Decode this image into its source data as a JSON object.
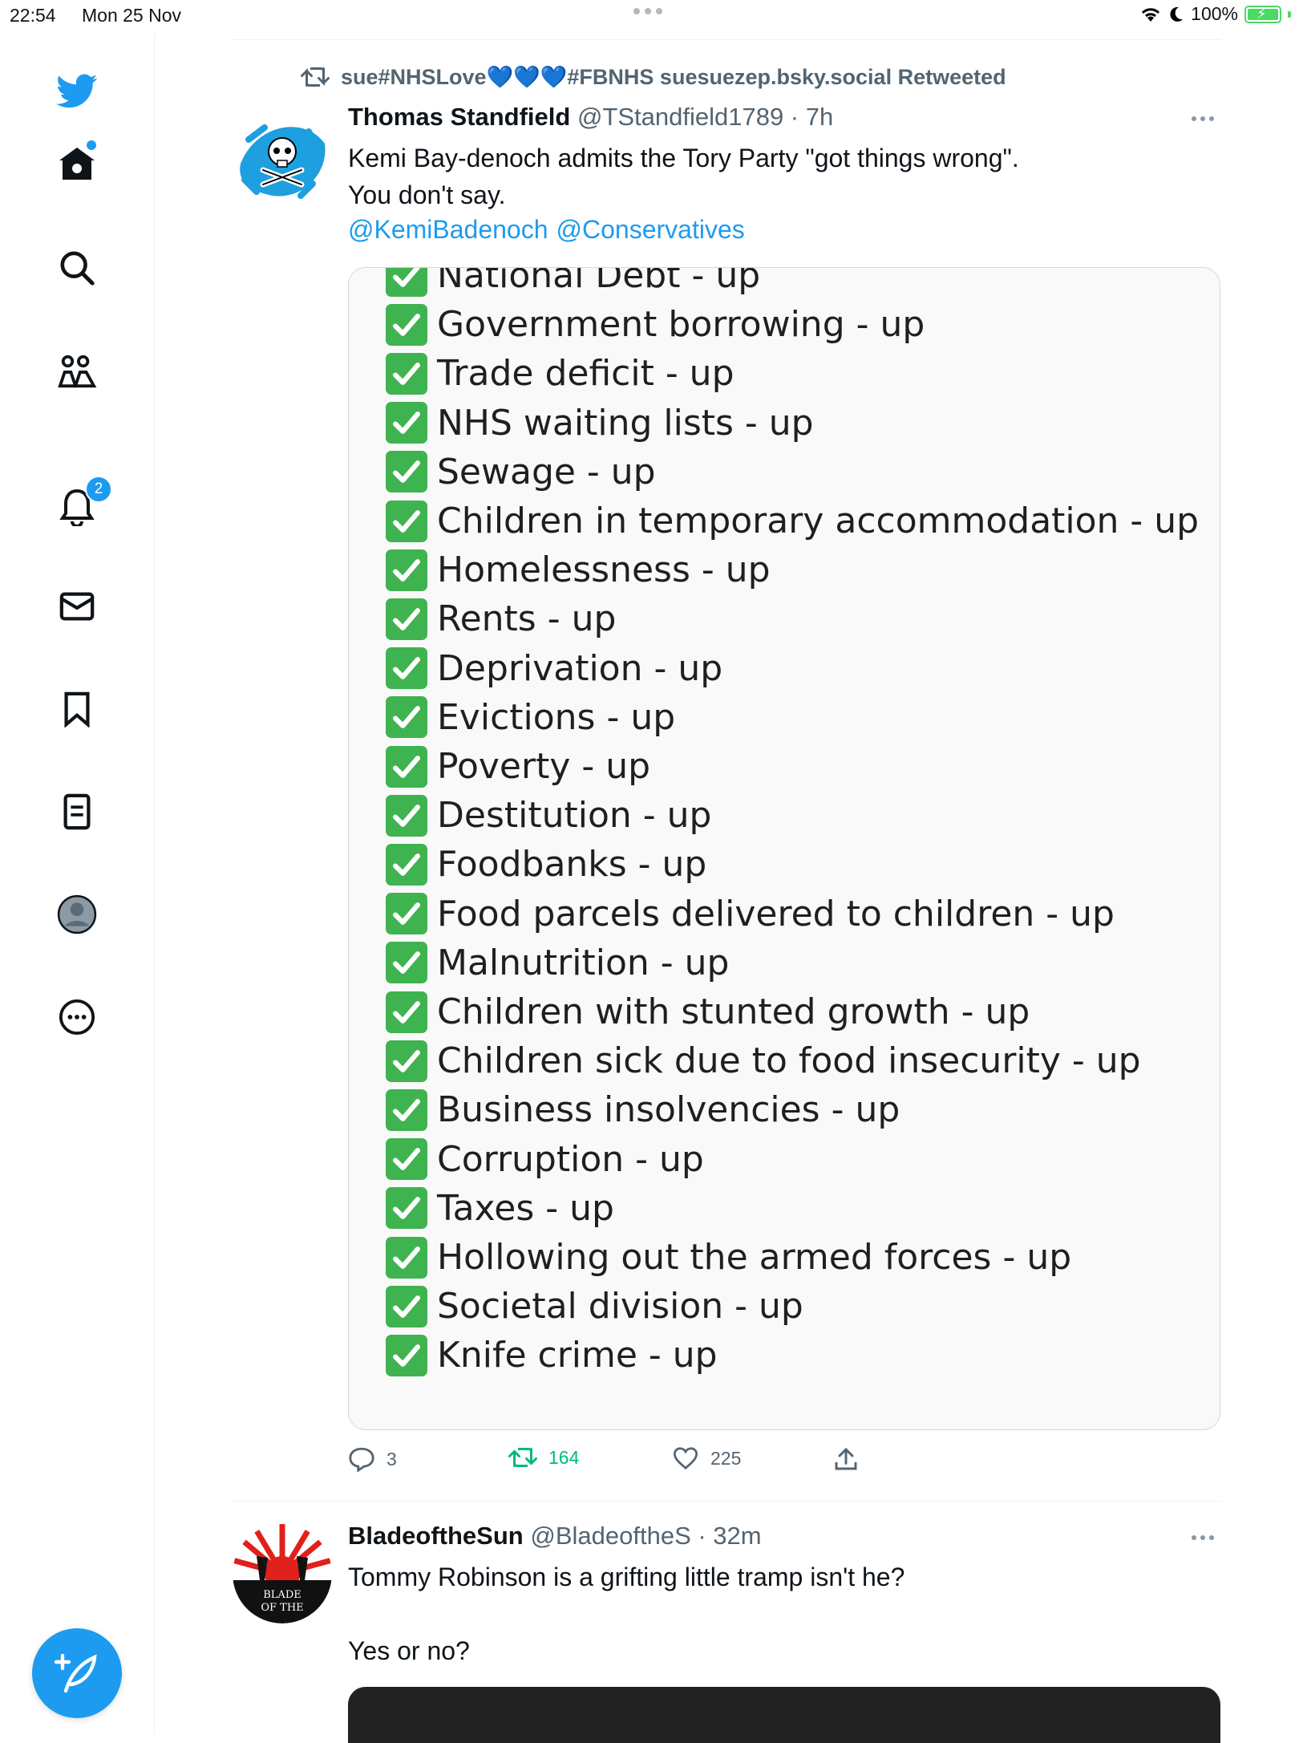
{
  "status_bar": {
    "time": "22:54",
    "date": "Mon 25 Nov",
    "battery": "100%"
  },
  "sidebar": {
    "items": [
      {
        "name": "twitter-logo"
      },
      {
        "name": "home"
      },
      {
        "name": "search"
      },
      {
        "name": "communities"
      },
      {
        "name": "notifications",
        "badge": "2"
      },
      {
        "name": "messages"
      },
      {
        "name": "bookmarks"
      },
      {
        "name": "lists"
      },
      {
        "name": "profile"
      },
      {
        "name": "more"
      }
    ],
    "compose_icon": "feather-plus-icon"
  },
  "retweet_banner": {
    "text": "sue#NHSLove💙💙💙#FBNHS suesuezep.bsky.social Retweeted"
  },
  "tweets": [
    {
      "name": "Thomas Standfield",
      "handle": "@TStandfield1789 · 7h",
      "text": "Kemi Bay-denoch admits the Tory Party \"got things wrong\".\nYou don't say.",
      "mentions": [
        "@KemiBadenoch",
        "@Conservatives"
      ],
      "list": [
        "National Debt - up",
        "Government borrowing - up",
        "Trade deficit - up",
        "NHS waiting lists - up",
        "Sewage - up",
        "Children in temporary accommodation - up",
        "Homelessness - up",
        "Rents - up",
        "Deprivation - up",
        "Evictions - up",
        "Poverty - up",
        "Destitution - up",
        "Foodbanks - up",
        "Food parcels delivered to children - up",
        "Malnutrition - up",
        "Children with stunted growth - up",
        "Children sick due to food insecurity - up",
        "Business insolvencies - up",
        "Corruption - up",
        "Taxes - up",
        "Hollowing out the armed forces - up",
        "Societal division - up",
        "Knife crime - up"
      ],
      "stats": {
        "replies": "3",
        "retweets": "164",
        "likes": "225"
      }
    },
    {
      "name": "BladeoftheSun",
      "handle": "@BladeoftheS · 32m",
      "text": "Tommy Robinson is a grifting little tramp isn't he?\n\nYes or no?",
      "avatar_text": "BLADE OF THE SUN"
    }
  ],
  "colors": {
    "accent": "#1d9bf0",
    "retweet_green": "#00ba7c",
    "check_green": "#3fb34f"
  }
}
